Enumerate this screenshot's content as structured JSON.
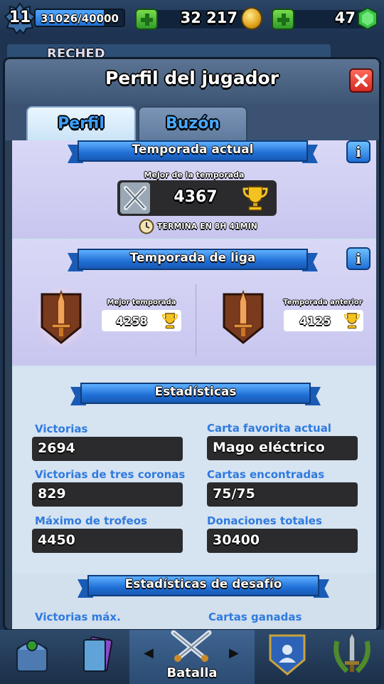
{
  "status_bar": {
    "level": "11",
    "xp_text": "31026/40000",
    "xp_progress": 0.776,
    "gold": "32 217",
    "gems": "47"
  },
  "background": {
    "clan_partial": "RECHED"
  },
  "dialog": {
    "title": "Perfil del jugador",
    "tabs": [
      {
        "label": "Perfil",
        "active": true
      },
      {
        "label": "Buzón",
        "active": false
      }
    ],
    "current_season": {
      "banner": "Temporada actual",
      "best_label": "Mejor de la temporada",
      "best_value": "4367",
      "ends_text": "TERMINA EN 8H 41MIN",
      "info": "i"
    },
    "league_season": {
      "banner": "Temporada de liga",
      "info": "i",
      "best_label": "Mejor temporada",
      "best_value": "4258",
      "previous_label": "Temporada anterior",
      "previous_value": "4125"
    },
    "statistics": {
      "banner": "Estadísticas",
      "items": [
        {
          "label": "Victorias",
          "value": "2694"
        },
        {
          "label": "Carta favorita actual",
          "value": "Mago eléctrico"
        },
        {
          "label": "Victorias de tres coronas",
          "value": "829"
        },
        {
          "label": "Cartas encontradas",
          "value": "75/75"
        },
        {
          "label": "Máximo de trofeos",
          "value": "4450"
        },
        {
          "label": "Donaciones totales",
          "value": "30400"
        }
      ]
    },
    "challenge_stats": {
      "banner": "Estadísticas de desafío",
      "items": [
        {
          "label": "Victorias máx."
        },
        {
          "label": "Cartas ganadas"
        }
      ]
    }
  },
  "bottom_nav": {
    "battle_label": "Batalla",
    "items": [
      "shop-chest-icon",
      "cards-icon",
      "battle-swords-icon",
      "clan-icon",
      "tournament-icon"
    ]
  },
  "colors": {
    "accent_blue": "#1f6fd6",
    "stat_label_blue": "#2f7ae0",
    "close_red": "#d42a23",
    "plus_green": "#2f9a2a"
  }
}
